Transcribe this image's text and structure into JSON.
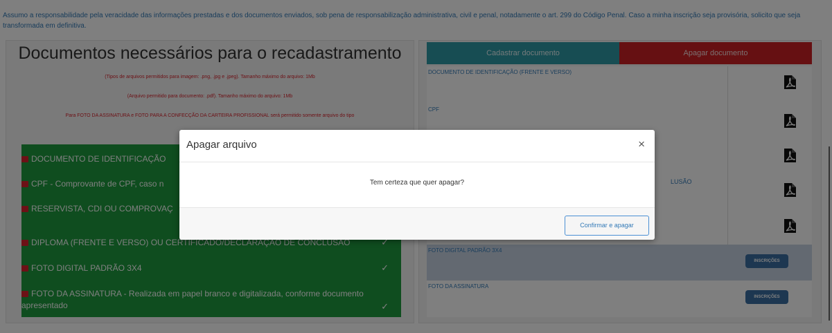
{
  "disclaimer": "Assumo a responsabilidade pela veracidade das informações prestadas e dos documentos enviados, sob pena de responsabilização administrativa, civil e penal, notadamente o art. 299 do Código Penal. Caso a minha inscrição seja provisória, solicito que seja transformada em definitiva.",
  "left": {
    "title": "Documentos necessários para o recadastramento",
    "note_image": "(Tipos de arquivos permitidos para imagem: .png, .jpg e .jpeg). Tamanho máximo do arquivo: 1Mb",
    "note_pdf": "(Arquivo permitido para documento: .pdf). Tamanho máximo do arquivo: 1Mb",
    "note_photo": "Para FOTO DA ASSINATURA e FOTO PARA A CONFECÇÃO DA CARTEIRA PROFISSIONAL será permitido somente arquivo do tipo",
    "documents": [
      {
        "label": "DOCUMENTO DE IDENTIFICAÇÃO",
        "check": ""
      },
      {
        "label": "CPF - Comprovante de CPF, caso n",
        "check": ""
      },
      {
        "label": "RESERVISTA, CDI OU COMPROVAÇ",
        "check": ""
      },
      {
        "label": "DIPLOMA (FRENTE E VERSO) OU CERTIFICADO/DECLARAÇÃO DE CONCLUSÃO",
        "check": "✓"
      },
      {
        "label": "FOTO DIGITAL PADRÃO 3X4",
        "check": "✓"
      },
      {
        "label": "FOTO DA ASSINATURA - Realizada em papel branco e digitalizada, conforme documento",
        "label2": "apresentado",
        "check": "✓"
      }
    ]
  },
  "right": {
    "add_button": "Cadastrar documento",
    "delete_button": "Apagar documento",
    "files": [
      {
        "label": "DOCUMENTO DE IDENTIFICAÇÃO (FRENTE E VERSO)",
        "icon": "pdf-icon"
      },
      {
        "label": "CPF",
        "icon": "pdf-icon"
      },
      {
        "label": "",
        "icon": "pdf-icon"
      },
      {
        "label": "LUSÃO",
        "icon": "pdf-icon"
      },
      {
        "label": "",
        "icon": "pdf-icon"
      },
      {
        "label": "FOTO DIGITAL PADRÃO 3X4",
        "badge": "INSCRIÇÕES"
      },
      {
        "label": "FOTO DA ASSINATURA",
        "badge": "INSCRIÇÕES"
      }
    ]
  },
  "modal": {
    "title": "Apagar arquivo",
    "close": "×",
    "message": "Tem certeza que quer apagar?",
    "confirm_button": "Confirmar e apagar"
  },
  "colors": {
    "accent_teal": "#2e9aa6",
    "danger_red": "#cc2025",
    "success_green": "#1e9a3e",
    "link_blue": "#337ab7"
  }
}
